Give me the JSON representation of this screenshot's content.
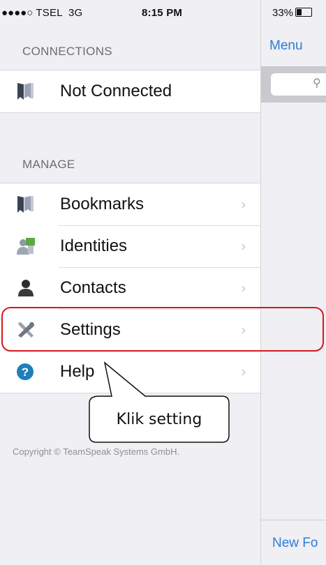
{
  "status_bar": {
    "signal": "●●●●○",
    "carrier": "TSEL",
    "network": "3G",
    "time": "8:15 PM",
    "battery": "33%"
  },
  "connections": {
    "header": "CONNECTIONS",
    "item_label": "Not Connected",
    "item_icon": "bookmark-icon"
  },
  "manage": {
    "header": "MANAGE",
    "items": [
      {
        "label": "Bookmarks",
        "icon": "bookmark-icon"
      },
      {
        "label": "Identities",
        "icon": "identities-icon"
      },
      {
        "label": "Contacts",
        "icon": "contact-icon"
      },
      {
        "label": "Settings",
        "icon": "tools-icon"
      },
      {
        "label": "Help",
        "icon": "help-icon"
      }
    ],
    "chevron": "›"
  },
  "copyright": "Copyright © TeamSpeak Systems GmbH.",
  "right_panel": {
    "menu_link": "Menu",
    "search_icon": "⚲",
    "bottom_link": "New Fo"
  },
  "annotation": {
    "callout_text": "Klik setting",
    "highlight_color": "#d21a1a"
  }
}
